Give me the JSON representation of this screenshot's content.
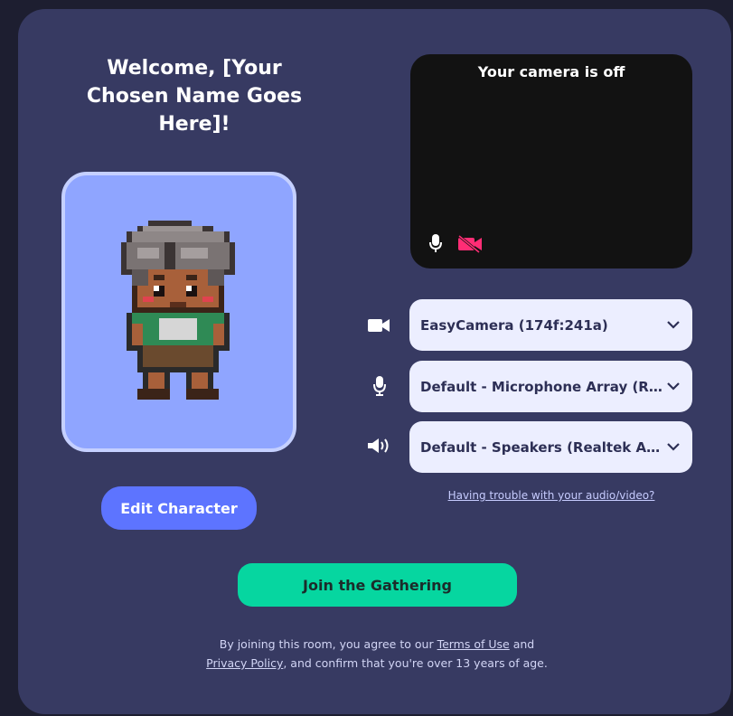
{
  "welcome": {
    "title": "Welcome, [Your Chosen Name Goes Here]!"
  },
  "avatar": {
    "edit_label": "Edit Character"
  },
  "camera_preview": {
    "message": "Your camera is off",
    "mic_icon": "microphone-icon",
    "camera_icon": "camera-off-icon"
  },
  "devices": {
    "camera": {
      "icon": "video-camera-icon",
      "selected": "EasyCamera (174f:241a)"
    },
    "microphone": {
      "icon": "microphone-icon",
      "selected": "Default - Microphone Array (Realtek)"
    },
    "speaker": {
      "icon": "speaker-icon",
      "selected": "Default - Speakers (Realtek Audio)"
    }
  },
  "help_link": "Having trouble with your audio/video?",
  "join_label": "Join the Gathering",
  "legal": {
    "prefix": "By joining this room, you agree to our ",
    "terms_link": "Terms of Use",
    "middle": " and ",
    "privacy_link": "Privacy Policy",
    "suffix": ", and confirm that you're over 13 years of age."
  },
  "colors": {
    "panel": "#373a62",
    "avatar_bg": "#8fa5ff",
    "edit_button": "#5d74ff",
    "join_button": "#06d6a0",
    "camera_off_accent": "#ff2d75"
  }
}
